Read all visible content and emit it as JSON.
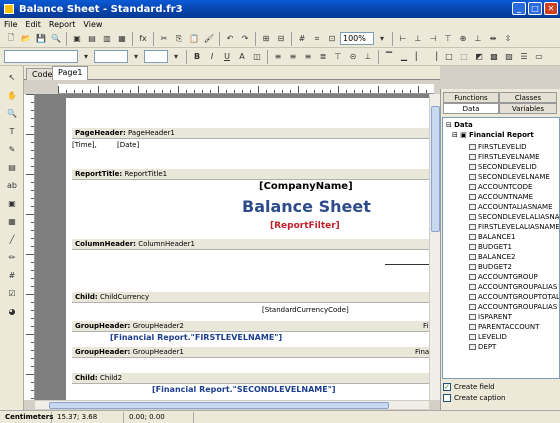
{
  "window": {
    "title": "Balance Sheet - Standard.fr3"
  },
  "menu": [
    "File",
    "Edit",
    "Report",
    "View"
  ],
  "toolbar": {
    "zoom": "100%"
  },
  "tabs": {
    "code": "Code",
    "page": "Page1"
  },
  "bands": {
    "pageheader": {
      "name": "PageHeader:",
      "obj": "PageHeader1"
    },
    "reporttitle": {
      "name": "ReportTitle:",
      "obj": "ReportTitle1"
    },
    "columnheader": {
      "name": "ColumnHeader:",
      "obj": "ColumnHeader1"
    },
    "child1": {
      "name": "Child:",
      "obj": "ChildCurrency"
    },
    "groupheader1": {
      "name": "GroupHeader:",
      "obj": "GroupHeader2"
    },
    "groupheader2": {
      "name": "GroupHeader:",
      "obj": "GroupHeader1"
    },
    "child2": {
      "name": "Child:",
      "obj": "Child2"
    }
  },
  "items": {
    "time": "[Time],",
    "date": "[Date]",
    "company": "[CompanyName]",
    "title": "Balance Sheet",
    "filter": "[ReportFilter]",
    "currency": "[StandardCurrencyCode]",
    "first": "[Financial Report.\"FIRSTLEVELNAME\"]",
    "second": "[Financial Report.\"SECONDLEVELNAME\"]",
    "fi": "Fi",
    "fina": "Fina"
  },
  "panel": {
    "tabs": {
      "functions": "Functions",
      "classes": "Classes",
      "data": "Data",
      "variables": "Variables"
    },
    "root": "Data",
    "dataset": "Financial Report",
    "fields": [
      "FIRSTLEVELID",
      "FIRSTLEVELNAME",
      "SECONDLEVELID",
      "SECONDLEVELNAME",
      "ACCOUNTCODE",
      "ACCOUNTNAME",
      "ACCOUNTALIASNAME",
      "SECONDLEVELALIASNAM",
      "FIRSTLEVELALIASNAME",
      "BALANCE1",
      "BUDGET1",
      "BALANCE2",
      "BUDGET2",
      "ACCOUNTGROUP",
      "ACCOUNTGROUPALIAS",
      "ACCOUNTGROUPTOTAL",
      "ACCOUNTGROUPALIAS",
      "ISPARENT",
      "PARENTACCOUNT",
      "LEVELID",
      "DEPT"
    ],
    "create_field": "Create field",
    "create_caption": "Create caption"
  },
  "status": {
    "unit": "Centimeters",
    "pos": "15.37; 3.68",
    "size": "0.00; 0.00"
  },
  "colors": {
    "title_blue": "#2e4c8c",
    "filter_red": "#c0202a",
    "field_blue": "#1d3f8f"
  }
}
